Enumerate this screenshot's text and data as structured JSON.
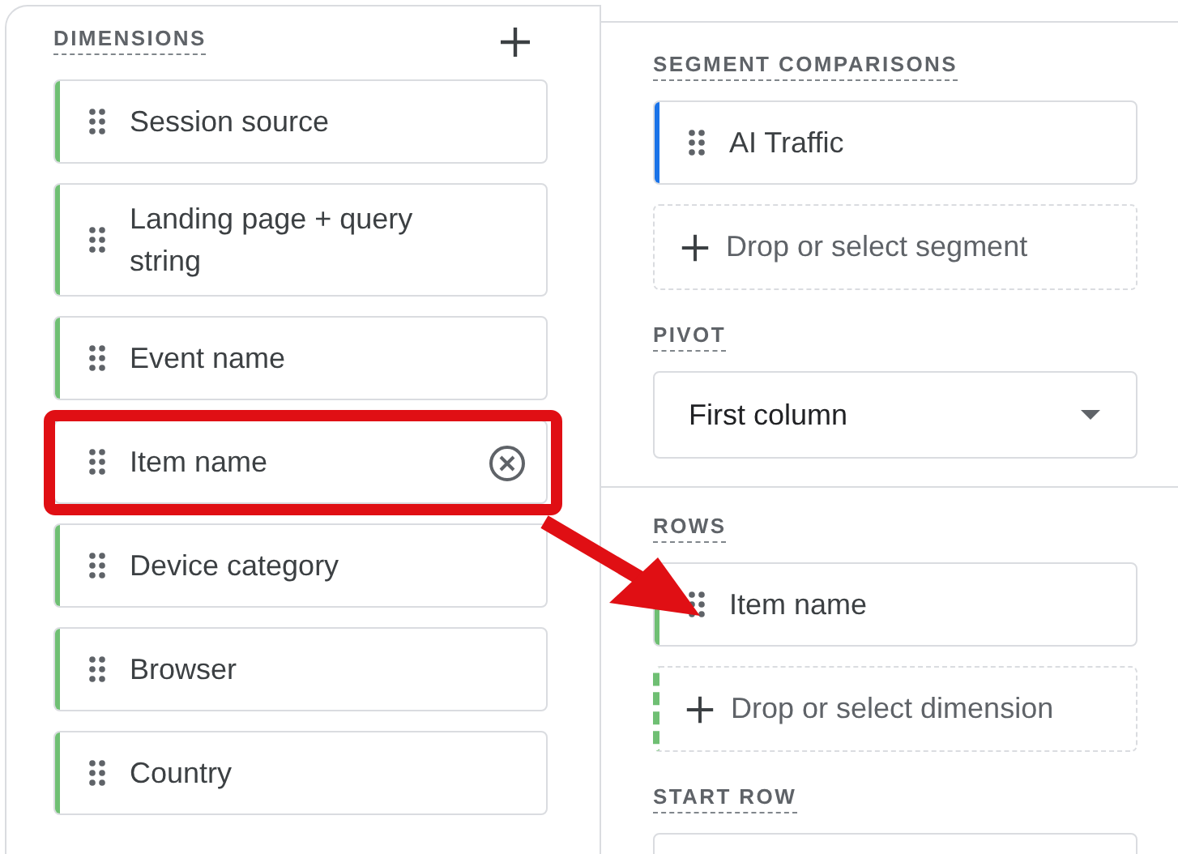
{
  "dimensions": {
    "title": "DIMENSIONS",
    "items": [
      {
        "label": "Session source",
        "highlighted": false
      },
      {
        "label": "Landing page + query string",
        "highlighted": false
      },
      {
        "label": "Event name",
        "highlighted": false
      },
      {
        "label": "Item name",
        "highlighted": true
      },
      {
        "label": "Device category",
        "highlighted": false
      },
      {
        "label": "Browser",
        "highlighted": false
      },
      {
        "label": "Country",
        "highlighted": false
      }
    ]
  },
  "segment_comparisons": {
    "title": "SEGMENT COMPARISONS",
    "items": [
      {
        "label": "AI Traffic",
        "color": "#1a73e8"
      }
    ],
    "add_label": "Drop or select segment"
  },
  "pivot": {
    "title": "PIVOT",
    "value": "First column"
  },
  "rows": {
    "title": "ROWS",
    "items": [
      {
        "label": "Item name",
        "color": "#6fbf73"
      }
    ],
    "add_label": "Drop or select dimension"
  },
  "start_row": {
    "title": "START ROW"
  }
}
